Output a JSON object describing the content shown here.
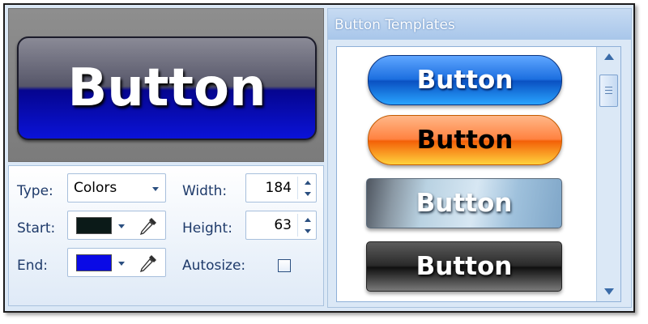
{
  "preview": {
    "button_label": "Button"
  },
  "properties": {
    "type_label": "Type:",
    "type_value": "Colors",
    "start_label": "Start:",
    "start_color": "#0b1a18",
    "end_label": "End:",
    "end_color": "#0a0ae6",
    "width_label": "Width:",
    "width_value": "184",
    "height_label": "Height:",
    "height_value": "63",
    "autosize_label": "Autosize:",
    "autosize_checked": false
  },
  "templates": {
    "title": "Button Templates",
    "items": [
      {
        "label": "Button",
        "style": "blue-glossy"
      },
      {
        "label": "Button",
        "style": "orange-glossy"
      },
      {
        "label": "Button",
        "style": "photo-light"
      },
      {
        "label": "Button",
        "style": "photo-dark"
      }
    ]
  },
  "colors": {
    "accent": "#2b4f80",
    "panel": "#dbe8f6"
  }
}
